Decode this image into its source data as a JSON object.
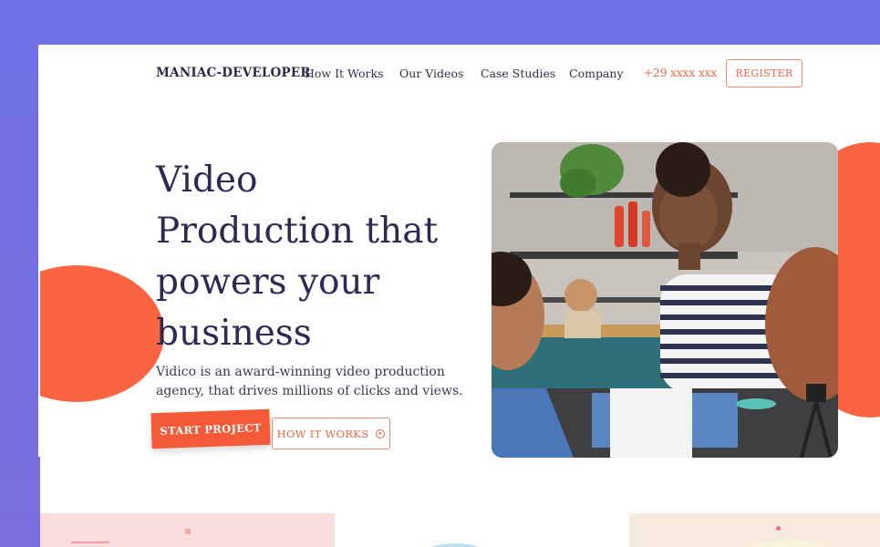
{
  "brand": {
    "logo": "MANIAC-DEVELOPER"
  },
  "nav": {
    "items": [
      {
        "label": "How It Works"
      },
      {
        "label": "Our Videos"
      },
      {
        "label": "Case Studies"
      },
      {
        "label": "Company"
      }
    ],
    "phone": "+29 xxxx xxx",
    "register_label": "REGISTER"
  },
  "hero": {
    "headline": "Video Production that powers your business",
    "subtext": "Vidico is an award-winning video production agency, that drives millions of clicks and views.",
    "primary_cta": "START PROJECT",
    "secondary_cta": "HOW IT WORKS"
  },
  "colors": {
    "accent": "#fa6440",
    "heading": "#2c2a55",
    "background_gradient": "#6f6fe6"
  }
}
